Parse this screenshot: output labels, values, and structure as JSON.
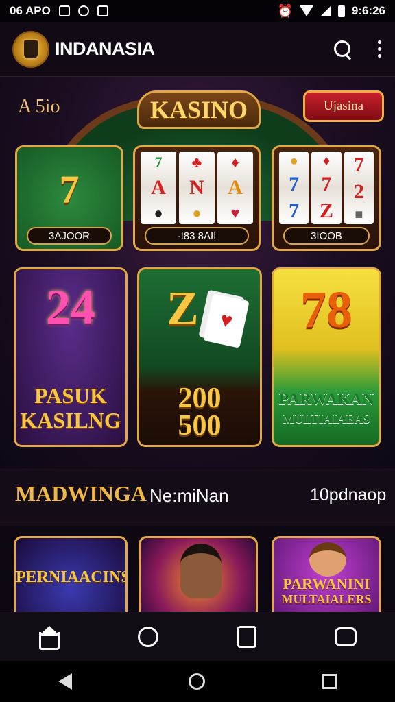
{
  "status_bar": {
    "left_text": "06 APO",
    "time": "9:6:26"
  },
  "app_bar": {
    "title": "INDANASIA"
  },
  "hero": {
    "section_label": "A 5io",
    "banner": "KASINO",
    "cta_button": "Ujasina",
    "slot_cards": [
      {
        "plate": "3AJOOR"
      },
      {
        "plate": "·I83 8AII"
      },
      {
        "plate": "3IOOB"
      }
    ],
    "promo_cards": [
      {
        "number": "24",
        "caption_line1": "PASUK",
        "caption_line2": "KASILNG"
      },
      {
        "number": "Z",
        "caption_line1": "200",
        "caption_line2": "500"
      },
      {
        "number": "78",
        "caption_line1": "PARWAKAN",
        "caption_line2": "MULTIAIAEAS"
      }
    ]
  },
  "section_tabs": {
    "tab1": "MADWINGA",
    "tab2": "Ne:miNan",
    "tab3": "10pdnaop"
  },
  "games": [
    {
      "label": "PERNIAACINS"
    },
    {
      "label": ""
    },
    {
      "label_line1": "PARWANINI",
      "label_line2": "MULTAIALERS"
    }
  ],
  "colors": {
    "gold": "#e2a846",
    "background": "#0d0812",
    "accent_red": "#c8202c",
    "felt_green": "#1f6e34"
  },
  "icons": [
    "home-icon",
    "chat-search-icon",
    "wallet-icon",
    "message-icon"
  ]
}
